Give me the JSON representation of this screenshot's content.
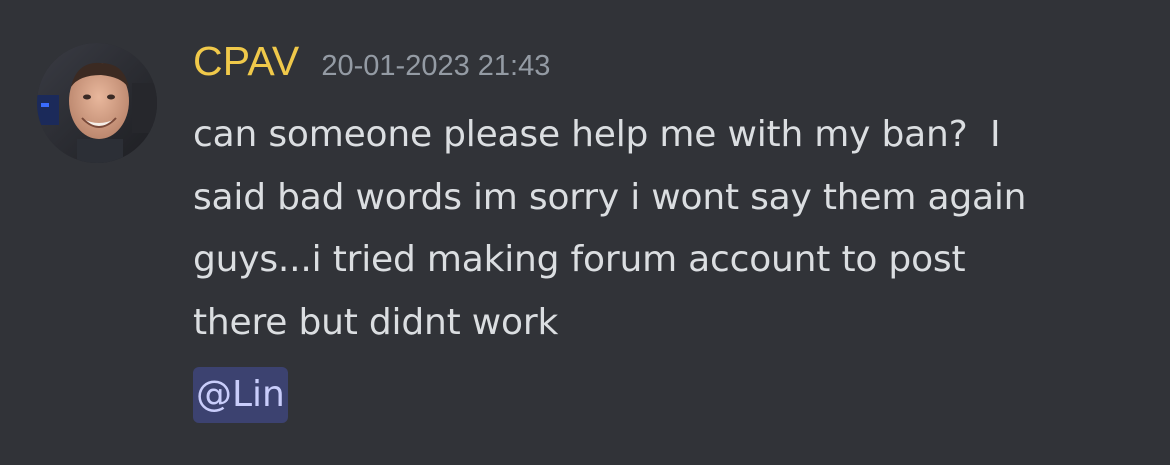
{
  "message": {
    "author": "CPAV",
    "timestamp": "20-01-2023 21:43",
    "lines": [
      "can someone please help me with my ban?  I",
      "said bad words im sorry i wont say them again",
      "guys...i tried making forum account to post",
      "there but didnt work"
    ],
    "mention": "@Lin"
  },
  "colors": {
    "background": "#313338",
    "author_name": "#f0c94a",
    "timestamp": "#949ba4",
    "message_text": "#dbdee1",
    "mention_bg": "#3c4270",
    "mention_text": "#c9cdfb"
  },
  "icons": {
    "avatar": "user-avatar-photo"
  }
}
